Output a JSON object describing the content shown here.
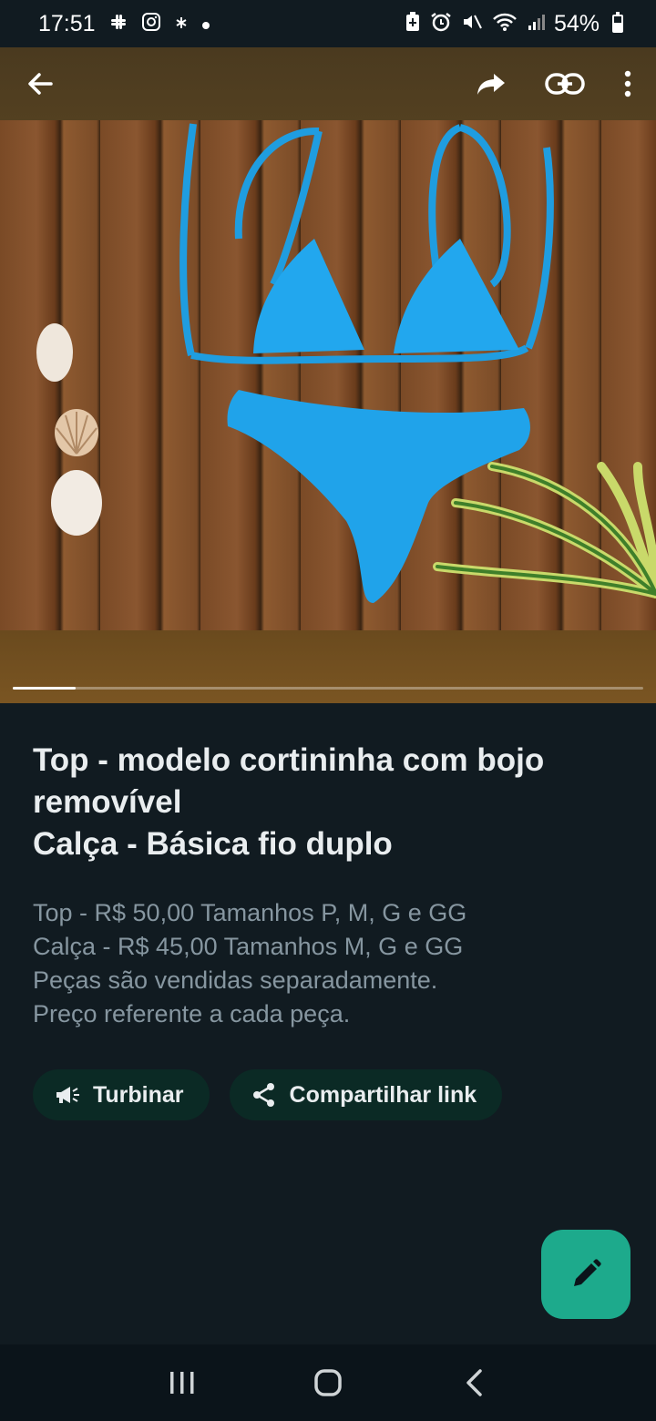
{
  "status_bar": {
    "time": "17:51",
    "battery": "54%",
    "left_icons": [
      "slack-icon",
      "instagram-icon",
      "asterisk-icon",
      "dot-icon"
    ],
    "right_icons": [
      "battery-saver-icon",
      "alarm-icon",
      "mute-icon",
      "wifi-icon",
      "signal-icon"
    ]
  },
  "media": {
    "progress": 0.1,
    "image_alt": "Blue bikini on wooden planks with seashells and plant"
  },
  "product": {
    "title_lines": [
      "Top - modelo cortininha com bojo",
      "removível",
      "Calça -  Básica fio duplo"
    ],
    "description_lines": [
      "Top - R$ 50,00 Tamanhos P, M, G e GG",
      "Calça - R$ 45,00 Tamanhos M, G e GG",
      "Peças são vendidas separadamente.",
      "Preço referente a cada peça."
    ]
  },
  "actions": {
    "boost_label": "Turbinar",
    "share_label": "Compartilhar link"
  },
  "colors": {
    "background": "#111b21",
    "accent": "#1daa8c",
    "chip_bg": "#0b2a25",
    "secondary_text": "#8696a0"
  }
}
